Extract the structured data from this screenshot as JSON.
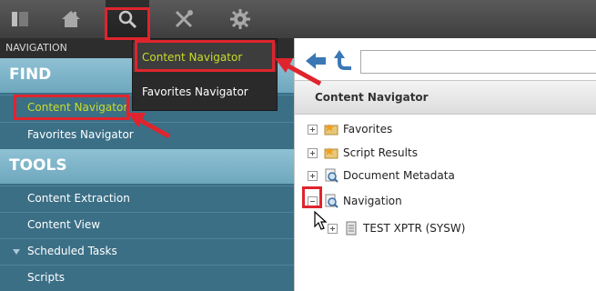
{
  "toolbar": {
    "icons": [
      "panel-icon",
      "home-icon",
      "search-icon",
      "tools-icon",
      "gear-icon"
    ],
    "active": "search-icon"
  },
  "nav": {
    "caption": "NAVIGATION",
    "find": {
      "title": "FIND",
      "items": [
        "Content Navigator",
        "Favorites Navigator"
      ]
    },
    "tools": {
      "title": "TOOLS",
      "items": [
        "Content Extraction",
        "Content View",
        "Scheduled Tasks",
        "Scripts"
      ]
    }
  },
  "popup": {
    "items": [
      "Content Navigator",
      "Favorites Navigator"
    ]
  },
  "content": {
    "pane_title": "Content Navigator",
    "tree": [
      {
        "label": "Favorites",
        "icon": "folder-star-icon",
        "expander": "plus"
      },
      {
        "label": "Script Results",
        "icon": "folder-star-icon",
        "expander": "plus"
      },
      {
        "label": "Document Metadata",
        "icon": "magnifier-doc-icon",
        "expander": "plus"
      },
      {
        "label": "Navigation",
        "icon": "magnifier-doc-icon",
        "expander": "minus"
      },
      {
        "label": "TEST XPTR (SYSW)",
        "icon": "database-icon",
        "expander": "plus"
      }
    ]
  },
  "colors": {
    "highlight": "#e0242d",
    "active_text": "#c8dc2a",
    "nav_bg": "#3b6f86",
    "section_bg": "#7fb4c8"
  }
}
